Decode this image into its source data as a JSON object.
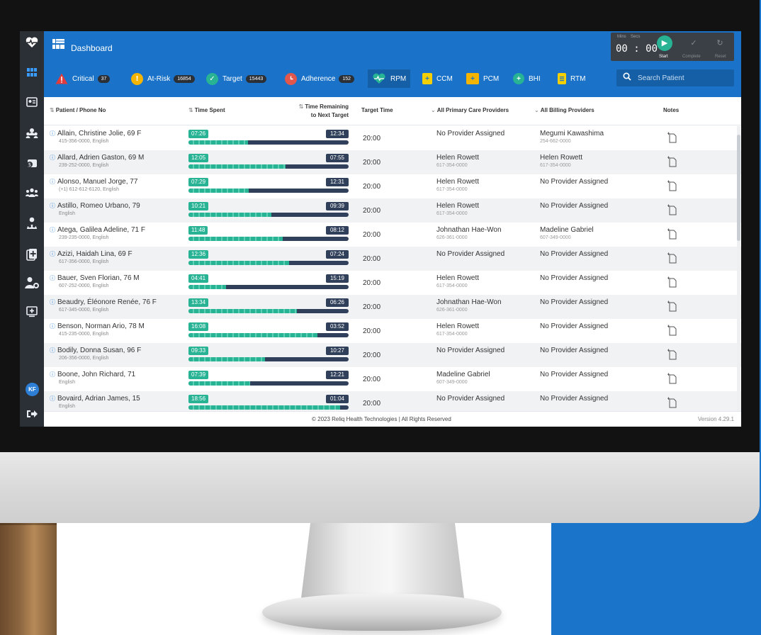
{
  "header": {
    "title": "Dashboard"
  },
  "timer": {
    "mins_label": "Mins",
    "secs_label": "Secs",
    "value": "00 : 00",
    "start_label": "Start",
    "complete_label": "Complete",
    "reset_label": "Reset"
  },
  "filters": {
    "critical": {
      "label": "Critical",
      "count": "37",
      "color": "#e23b3b"
    },
    "at_risk": {
      "label": "At-Risk",
      "count": "16854",
      "color": "#f4b400"
    },
    "target": {
      "label": "Target",
      "count": "15443",
      "color": "#27b394"
    },
    "adherence": {
      "label": "Adherence",
      "count": "152",
      "color": "#e2574c"
    }
  },
  "programs": [
    "RPM",
    "CCM",
    "PCM",
    "BHI",
    "RTM"
  ],
  "selected_program": "RPM",
  "search": {
    "placeholder": "Search Patient"
  },
  "columns": {
    "patient": "Patient / Phone No",
    "time_spent": "Time Spent",
    "time_remaining": "Time Remaining",
    "time_remaining_2": "to Next Target",
    "target_time": "Target Time",
    "primary": "All Primary Care Providers",
    "billing": "All Billing Providers",
    "notes": "Notes"
  },
  "patients": [
    {
      "name": "Allain, Christine Jolie, 69 F",
      "sub": "415-356-0000, English",
      "spent": "07:26",
      "remaining": "12:34",
      "progress": 0.372,
      "target": "20:00",
      "primary": "No Provider Assigned",
      "primary_phone": "",
      "billing": "Megumi Kawashima",
      "billing_phone": "254-662-0000"
    },
    {
      "name": "Allard, Adrien Gaston, 69 M",
      "sub": "239-252-0000, English",
      "spent": "12:05",
      "remaining": "07:55",
      "progress": 0.604,
      "target": "20:00",
      "primary": "Helen Rowett",
      "primary_phone": "617-354-0000",
      "billing": "Helen Rowett",
      "billing_phone": "617-354-0000"
    },
    {
      "name": "Alonso, Manuel Jorge, 77",
      "sub": "(+1) 612-612-6120, English",
      "spent": "07:29",
      "remaining": "12:31",
      "progress": 0.374,
      "target": "20:00",
      "primary": "Helen Rowett",
      "primary_phone": "617-354-0000",
      "billing": "No Provider Assigned",
      "billing_phone": ""
    },
    {
      "name": "Astillo, Romeo Urbano, 79",
      "sub": "English",
      "spent": "10:21",
      "remaining": "09:39",
      "progress": 0.518,
      "target": "20:00",
      "primary": "Helen Rowett",
      "primary_phone": "617-354-0000",
      "billing": "No Provider Assigned",
      "billing_phone": ""
    },
    {
      "name": "Atega, Galilea Adeline, 71 F",
      "sub": "239-235-0000, English",
      "spent": "11:48",
      "remaining": "08:12",
      "progress": 0.59,
      "target": "20:00",
      "primary": "Johnathan Hae-Won",
      "primary_phone": "626-361-0000",
      "billing": "Madeline Gabriel",
      "billing_phone": "607-349-0000"
    },
    {
      "name": "Azizi, Haidah Lina, 69 F",
      "sub": "617-356-0000, English",
      "spent": "12:36",
      "remaining": "07:24",
      "progress": 0.63,
      "target": "20:00",
      "primary": "No Provider Assigned",
      "primary_phone": "",
      "billing": "No Provider Assigned",
      "billing_phone": ""
    },
    {
      "name": "Bauer, Sven Florian, 76 M",
      "sub": "607-252-0000, English",
      "spent": "04:41",
      "remaining": "15:19",
      "progress": 0.234,
      "target": "20:00",
      "primary": "Helen Rowett",
      "primary_phone": "617-354-0000",
      "billing": "No Provider Assigned",
      "billing_phone": ""
    },
    {
      "name": "Beaudry, Éléonore Renée, 76 F",
      "sub": "617-345-0000, English",
      "spent": "13:34",
      "remaining": "06:26",
      "progress": 0.678,
      "target": "20:00",
      "primary": "Johnathan Hae-Won",
      "primary_phone": "626-361-0000",
      "billing": "No Provider Assigned",
      "billing_phone": ""
    },
    {
      "name": "Benson, Norman Ario, 78 M",
      "sub": "415-235-0000, English",
      "spent": "16:08",
      "remaining": "03:52",
      "progress": 0.807,
      "target": "20:00",
      "primary": "Helen Rowett",
      "primary_phone": "617-354-0000",
      "billing": "No Provider Assigned",
      "billing_phone": ""
    },
    {
      "name": "Bodily, Donna Susan, 96 F",
      "sub": "206-356-0000, English",
      "spent": "09:33",
      "remaining": "10:27",
      "progress": 0.478,
      "target": "20:00",
      "primary": "No Provider Assigned",
      "primary_phone": "",
      "billing": "No Provider Assigned",
      "billing_phone": ""
    },
    {
      "name": "Boone, John Richard, 71",
      "sub": "English",
      "spent": "07:39",
      "remaining": "12:21",
      "progress": 0.383,
      "target": "20:00",
      "primary": "Madeline Gabriel",
      "primary_phone": "607-349-0000",
      "billing": "No Provider Assigned",
      "billing_phone": ""
    },
    {
      "name": "Bovaird, Adrian James, 15",
      "sub": "English",
      "spent": "18:56",
      "remaining": "01:04",
      "progress": 0.947,
      "target": "20:00",
      "primary": "No Provider Assigned",
      "primary_phone": "",
      "billing": "No Provider Assigned",
      "billing_phone": ""
    }
  ],
  "footer": {
    "copyright": "© 2023 Reliq Health Technologies | All Rights Reserved",
    "version": "Version 4.29.1"
  },
  "user": {
    "initials": "KF"
  },
  "sidebar_icons": [
    "dashboard-icon",
    "patient-card-icon",
    "care-team-icon",
    "billing-icon",
    "groups-icon",
    "patient-glasses-icon",
    "add-record-icon",
    "user-settings-icon",
    "monitor-plus-icon",
    "logout-icon"
  ]
}
